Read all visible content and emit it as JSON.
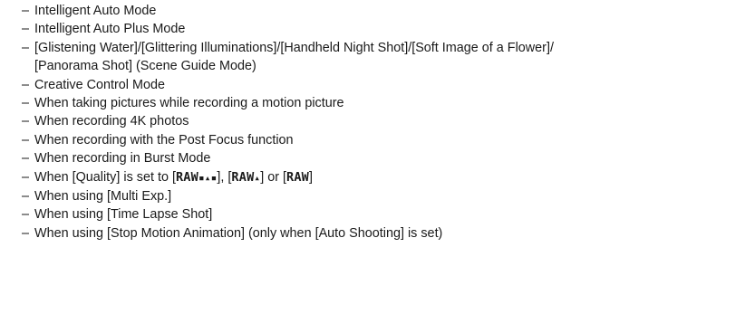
{
  "dash": "–",
  "items": [
    {
      "text": "Intelligent Auto Mode"
    },
    {
      "text": "Intelligent Auto Plus Mode"
    },
    {
      "line1": "[Glistening Water]/[Glittering Illuminations]/[Handheld Night Shot]/[Soft Image of a Flower]/",
      "line2": "[Panorama Shot] (Scene Guide Mode)"
    },
    {
      "text": "Creative Control Mode"
    },
    {
      "text": "When taking pictures while recording a motion picture"
    },
    {
      "text": "When recording 4K photos"
    },
    {
      "text": "When recording with the Post Focus function"
    },
    {
      "text": "When recording in Burst Mode"
    },
    {
      "prefix": "When [Quality] is set to [",
      "raw1": "RAW",
      "q1": "▪▴▪",
      "mid1": "], [",
      "raw2": "RAW",
      "q2": "▴",
      "mid2": "] or [",
      "raw3": "RAW",
      "suffix": "]"
    },
    {
      "text": "When using [Multi Exp.]"
    },
    {
      "text": "When using [Time Lapse Shot]"
    },
    {
      "text": "When using [Stop Motion Animation] (only when [Auto Shooting] is set)"
    }
  ]
}
